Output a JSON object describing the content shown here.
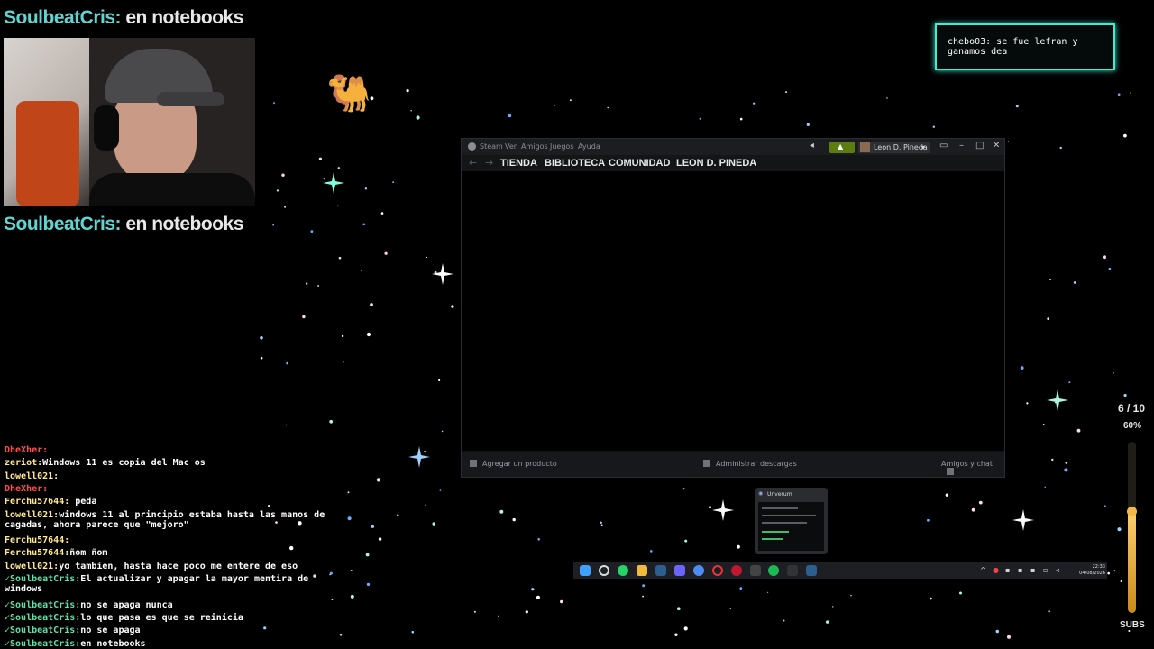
{
  "stream_overlay": {
    "top_banner": {
      "user": "SoulbeatCris:",
      "message": "en notebooks"
    },
    "mid_banner": {
      "user": "SoulbeatCris:",
      "message": "en notebooks"
    },
    "highlight_chat": "chebo03: se fue lefran y ganamos dea",
    "sub_goal": {
      "count": "6 / 10",
      "percent": "60%",
      "label": "SUBS",
      "fraction": 0.6
    }
  },
  "steam": {
    "menu": [
      "Steam",
      "Ver",
      "Amigos",
      "Juegos",
      "Ayuda"
    ],
    "account": "Leon D. Pineda",
    "nav": [
      "TIENDA",
      "BIBLIOTECA",
      "COMUNIDAD",
      "LEON D. PINEDA"
    ],
    "footer": {
      "add_product": "Agregar un producto",
      "downloads": "Administrar descargas",
      "friends": "Amigos y chat"
    }
  },
  "taskbar": {
    "preview_title": "Unverum",
    "time": "22:33",
    "date": "04/08/2026"
  },
  "chat_log": [
    {
      "user": "DheXher:",
      "text": "",
      "color": "red"
    },
    {
      "user": "zeriot:",
      "text": "Windows 11 es copia del Mac os",
      "color": "yellow"
    },
    {
      "user": "lowell021:",
      "text": "",
      "color": "yellow"
    },
    {
      "user": "DheXher:",
      "text": "",
      "color": "red"
    },
    {
      "user": "Ferchu57644:",
      "text": " peda",
      "color": "yellow"
    },
    {
      "user": "lowell021:",
      "text": "windows 11 al principio estaba hasta las manos de\ncagadas, ahora parece que \"mejoro\"",
      "color": "yellow"
    },
    {
      "user": "Ferchu57644:",
      "text": "",
      "color": "yellow"
    },
    {
      "user": "Ferchu57644:",
      "text": "ñom ñom",
      "color": "yellow"
    },
    {
      "user": "lowell021:",
      "text": "yo tambien, hasta hace poco me entere de eso",
      "color": "yellow"
    },
    {
      "user": "SoulbeatCris:",
      "text": "El actualizar y apagar la mayor mentira de\nwindows",
      "color": "cyan"
    },
    {
      "user": "SoulbeatCris:",
      "text": "no se apaga nunca",
      "color": "cyan"
    },
    {
      "user": "SoulbeatCris:",
      "text": "lo que pasa es que se reinicia",
      "color": "cyan"
    },
    {
      "user": "SoulbeatCris:",
      "text": "no se apaga",
      "color": "cyan"
    },
    {
      "user": "SoulbeatCris:",
      "text": "en notebooks",
      "color": "cyan"
    }
  ],
  "colors": {
    "accent": "#49e8d0",
    "steam_green": "#5c7e10",
    "chat_user": "#ffe98a"
  },
  "icons": [
    "windows-start-icon",
    "search-icon",
    "whatsapp-icon",
    "folder-icon",
    "steam-icon",
    "spotify-icon"
  ]
}
